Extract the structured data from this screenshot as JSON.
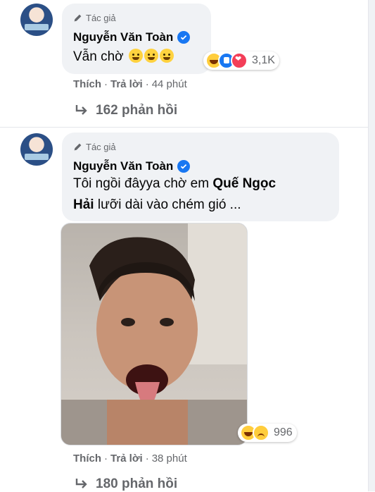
{
  "comments": [
    {
      "badge": "Tác giả",
      "author": "Nguyễn Văn Toàn",
      "text_line1": "Vẫn chờ",
      "reaction_count": "3,1K",
      "actions": {
        "like": "Thích",
        "reply": "Trả lời",
        "time": "44 phút"
      },
      "replies": "162 phản hồi"
    },
    {
      "badge": "Tác giả",
      "author": "Nguyễn Văn Toàn",
      "text_line1_pre": "Tôi ngồi đâyya chờ em ",
      "text_line1_bold": "Quế Ngọc",
      "text_line2_bold": "Hải",
      "text_line2_post": " lưỡi dài vào chém gió ...",
      "reaction_count": "996",
      "actions": {
        "like": "Thích",
        "reply": "Trả lời",
        "time": "38 phút"
      },
      "replies": "180 phản hồi"
    }
  ],
  "colors": {
    "bubble": "#f0f2f5",
    "verified": "#1877f2",
    "muted_text": "#65676b"
  },
  "icons": [
    "pencil-icon",
    "verified-icon",
    "haha-reaction-icon",
    "like-reaction-icon",
    "love-reaction-icon",
    "sad-reaction-icon",
    "reply-arrow-icon"
  ]
}
